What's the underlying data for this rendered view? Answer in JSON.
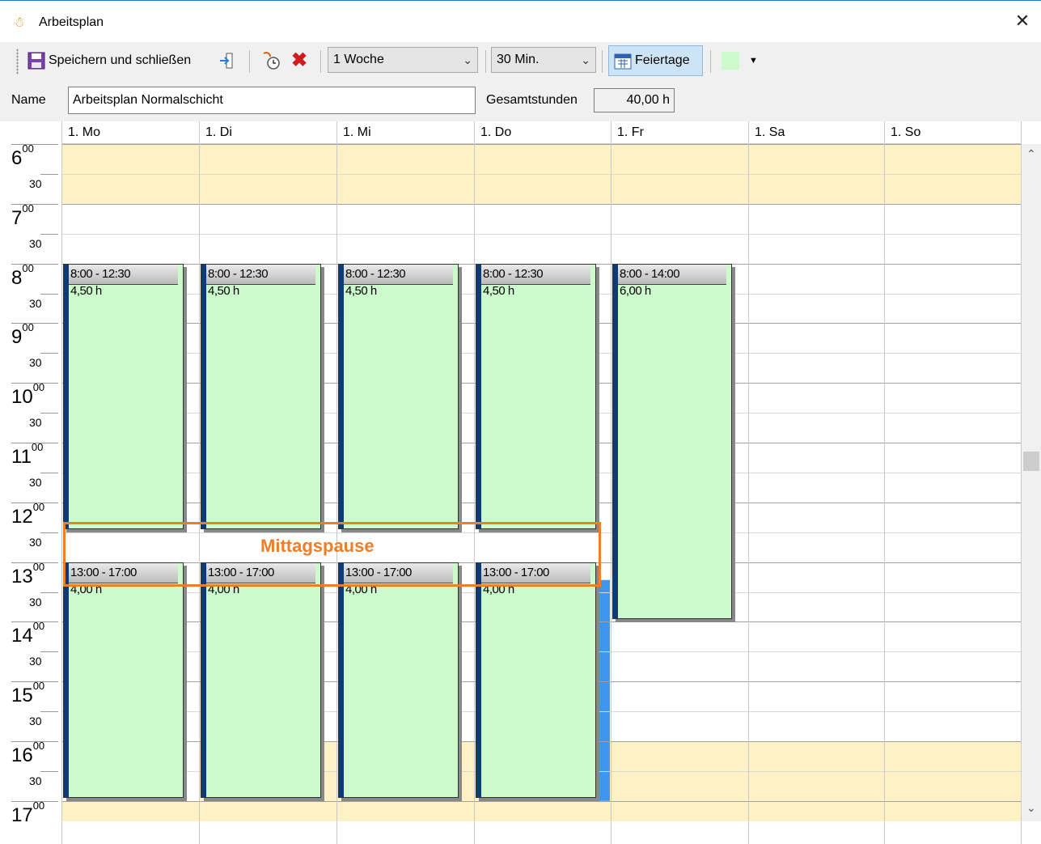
{
  "window": {
    "title": "Arbeitsplan"
  },
  "toolbar": {
    "save_label": "Speichern und schließen",
    "week_combo": "1 Woche",
    "interval_combo": "30 Min.",
    "holidays_label": "Feiertage"
  },
  "form": {
    "name_label": "Name",
    "name_value": "Arbeitsplan Normalschicht",
    "total_label": "Gesamtstunden",
    "total_value": "40,00 h"
  },
  "days": [
    "1. Mo",
    "1. Di",
    "1. Mi",
    "1. Do",
    "1. Fr",
    "1. Sa",
    "1. So"
  ],
  "time_labels": {
    "hours": [
      "6",
      "7",
      "8",
      "9",
      "10",
      "11",
      "12",
      "13",
      "14",
      "15",
      "16",
      "17"
    ],
    "minutes_full": "00",
    "minutes_half": "30"
  },
  "appointments": [
    {
      "day": 0,
      "range": "8:00 - 12:30",
      "hours": "4,50 h"
    },
    {
      "day": 1,
      "range": "8:00 - 12:30",
      "hours": "4,50 h"
    },
    {
      "day": 2,
      "range": "8:00 - 12:30",
      "hours": "4,50 h"
    },
    {
      "day": 3,
      "range": "8:00 - 12:30",
      "hours": "4,50 h"
    },
    {
      "day": 4,
      "range": "8:00 - 14:00",
      "hours": "6,00 h"
    },
    {
      "day": 0,
      "range": "13:00 - 17:00",
      "hours": "4,00 h"
    },
    {
      "day": 1,
      "range": "13:00 - 17:00",
      "hours": "4,00 h"
    },
    {
      "day": 2,
      "range": "13:00 - 17:00",
      "hours": "4,00 h"
    },
    {
      "day": 3,
      "range": "13:00 - 17:00",
      "hours": "4,00 h"
    }
  ],
  "annotation": "Mittagspause",
  "colors": {
    "offhours": "#fef2c4",
    "appointment": "#ccfacc",
    "accent": "#f07d27",
    "selection": "#3f96ee"
  }
}
